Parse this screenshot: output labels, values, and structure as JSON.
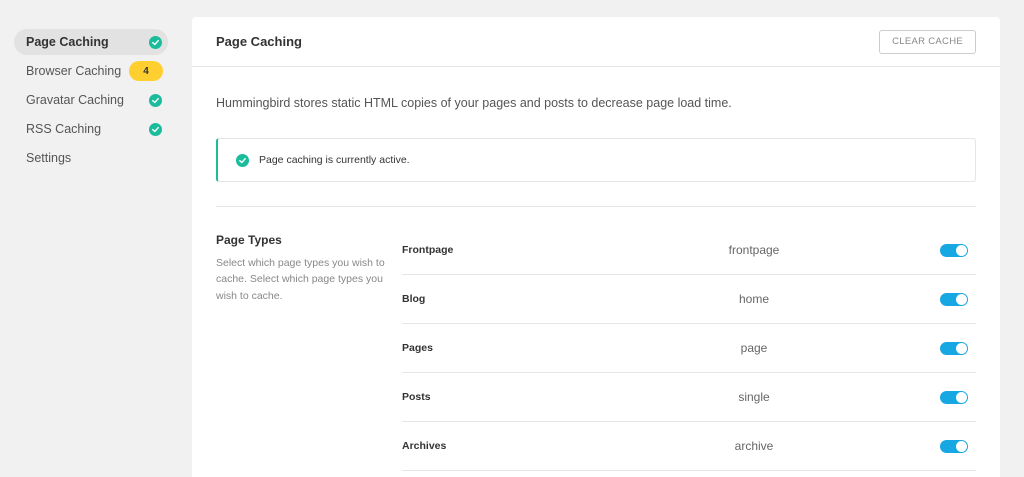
{
  "sidebar": {
    "items": [
      {
        "label": "Page Caching",
        "status": "ok"
      },
      {
        "label": "Browser Caching",
        "badge": "4"
      },
      {
        "label": "Gravatar Caching",
        "status": "ok"
      },
      {
        "label": "RSS Caching",
        "status": "ok"
      },
      {
        "label": "Settings"
      }
    ]
  },
  "panel": {
    "title": "Page Caching",
    "clear_button": "CLEAR CACHE",
    "intro": "Hummingbird stores static HTML copies of your pages and posts to decrease page load time.",
    "notice": "Page caching is currently active."
  },
  "page_types": {
    "title": "Page Types",
    "description": "Select which page types you wish to cache. Select which page types you wish to cache.",
    "rows": [
      {
        "name": "Frontpage",
        "slug": "frontpage",
        "enabled": true
      },
      {
        "name": "Blog",
        "slug": "home",
        "enabled": true
      },
      {
        "name": "Pages",
        "slug": "page",
        "enabled": true
      },
      {
        "name": "Posts",
        "slug": "single",
        "enabled": true
      },
      {
        "name": "Archives",
        "slug": "archive",
        "enabled": true
      }
    ]
  },
  "colors": {
    "accent_green": "#1abc9c",
    "toggle_blue": "#17a8e3",
    "badge_yellow": "#fecf2f"
  }
}
